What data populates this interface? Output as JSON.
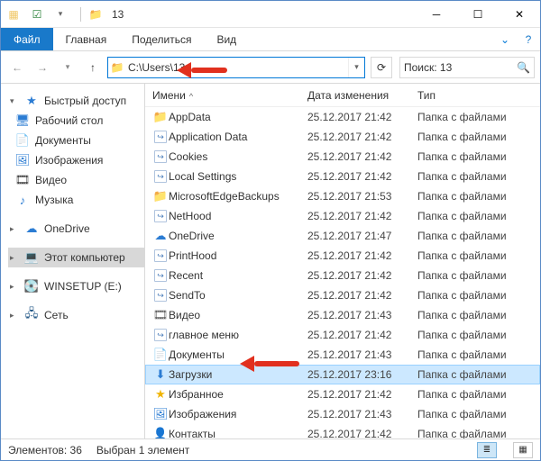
{
  "title_text": "13",
  "ribbon": {
    "file": "Файл",
    "home": "Главная",
    "share": "Поделиться",
    "view": "Вид"
  },
  "address": "C:\\Users\\13",
  "search_placeholder": "Поиск: 13",
  "columns": {
    "name": "Имени",
    "date": "Дата изменения",
    "type": "Тип"
  },
  "nav": {
    "quick": "Быстрый доступ",
    "desktop": "Рабочий стол",
    "documents": "Документы",
    "pictures": "Изображения",
    "videos": "Видео",
    "music": "Музыка",
    "onedrive": "OneDrive",
    "thispc": "Этот компьютер",
    "drive": "WINSETUP (E:)",
    "network": "Сеть"
  },
  "file_type_folder": "Папка с файлами",
  "files": [
    {
      "icon": "folder",
      "name": "AppData",
      "date": "25.12.2017 21:42"
    },
    {
      "icon": "link",
      "name": "Application Data",
      "date": "25.12.2017 21:42"
    },
    {
      "icon": "link",
      "name": "Cookies",
      "date": "25.12.2017 21:42"
    },
    {
      "icon": "link",
      "name": "Local Settings",
      "date": "25.12.2017 21:42"
    },
    {
      "icon": "folder",
      "name": "MicrosoftEdgeBackups",
      "date": "25.12.2017 21:53"
    },
    {
      "icon": "link",
      "name": "NetHood",
      "date": "25.12.2017 21:42"
    },
    {
      "icon": "onedrive",
      "name": "OneDrive",
      "date": "25.12.2017 21:47"
    },
    {
      "icon": "link",
      "name": "PrintHood",
      "date": "25.12.2017 21:42"
    },
    {
      "icon": "link",
      "name": "Recent",
      "date": "25.12.2017 21:42"
    },
    {
      "icon": "link",
      "name": "SendTo",
      "date": "25.12.2017 21:42"
    },
    {
      "icon": "video",
      "name": "Видео",
      "date": "25.12.2017 21:43"
    },
    {
      "icon": "link",
      "name": "главное меню",
      "date": "25.12.2017 21:42"
    },
    {
      "icon": "docs",
      "name": "Документы",
      "date": "25.12.2017 21:43"
    },
    {
      "icon": "downloads",
      "name": "Загрузки",
      "date": "25.12.2017 23:16",
      "selected": true
    },
    {
      "icon": "fav",
      "name": "Избранное",
      "date": "25.12.2017 21:42"
    },
    {
      "icon": "pics",
      "name": "Изображения",
      "date": "25.12.2017 21:43"
    },
    {
      "icon": "contacts",
      "name": "Контакты",
      "date": "25.12.2017 21:42"
    }
  ],
  "status": {
    "count_label": "Элементов: 36",
    "sel_label": "Выбран 1 элемент"
  },
  "icons": {
    "folder": "📁",
    "link": "↪",
    "onedrive": "☁",
    "video": "🎞",
    "docs": "📄",
    "downloads": "⬇",
    "fav": "★",
    "pics": "🖼",
    "contacts": "👤",
    "music": "♪",
    "desktop": "🖥",
    "drive": "💽",
    "network": "🖧",
    "thispc": "💻",
    "quick": "★"
  }
}
